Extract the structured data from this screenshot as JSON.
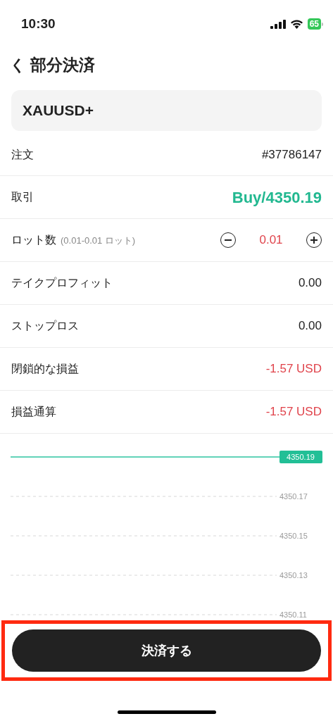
{
  "status_bar": {
    "time": "10:30",
    "battery": "65"
  },
  "header": {
    "back": "く",
    "title": "部分決済"
  },
  "symbol": "XAUUSD+",
  "rows": [
    {
      "kind": "text",
      "label": "注文",
      "value": "#37786147",
      "color": "#222222"
    },
    {
      "kind": "trade",
      "label": "取引",
      "value": "Buy/4350.19",
      "color": "#22b890"
    },
    {
      "kind": "lot",
      "label": "ロット数",
      "hint": "(0.01-0.01 ロット)",
      "value": "0.01",
      "color": "#e0434b"
    },
    {
      "kind": "text",
      "label": "テイクプロフィット",
      "value": "0.00",
      "color": "#222222"
    },
    {
      "kind": "text",
      "label": "ストップロス",
      "value": "0.00",
      "color": "#222222"
    },
    {
      "kind": "text",
      "label": "閉鎖的な損益",
      "value": "-1.57 USD",
      "color": "#e0434b"
    },
    {
      "kind": "text",
      "label": "損益通算",
      "value": "-1.57 USD",
      "color": "#e0434b"
    }
  ],
  "price_chart": {
    "current_price": "4350.19",
    "price_levels": [
      "4350.17",
      "4350.15",
      "4350.13",
      "4350.11"
    ]
  },
  "close_button": {
    "label": "決済する",
    "highlighted": true
  }
}
